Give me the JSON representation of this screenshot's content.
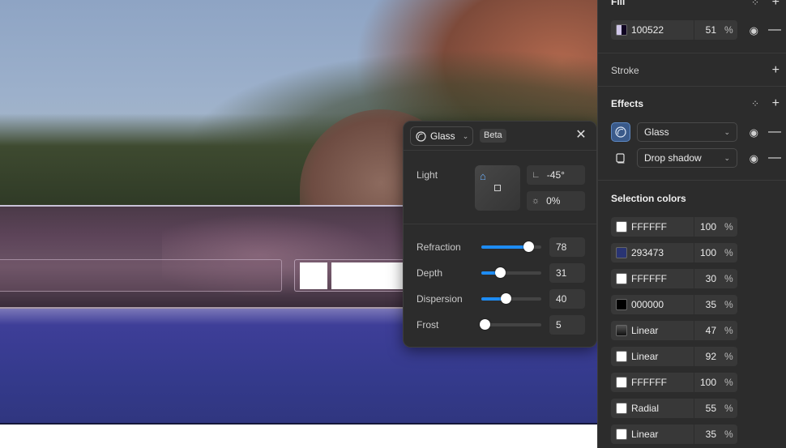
{
  "effect_popup": {
    "effect_name": "Glass",
    "beta_label": "Beta",
    "light_label": "Light",
    "angle": "-45°",
    "intensity": "0%",
    "sliders": [
      {
        "label": "Refraction",
        "value": "78",
        "level": 0.78
      },
      {
        "label": "Depth",
        "value": "31",
        "level": 0.31
      },
      {
        "label": "Dispersion",
        "value": "40",
        "level": 0.4
      },
      {
        "label": "Frost",
        "value": "5",
        "level": 0.05
      }
    ]
  },
  "panel": {
    "fill": {
      "title": "Fill",
      "hex": "100522",
      "opacity": "51",
      "percent_sign": "%",
      "swatch_color": "#100522"
    },
    "stroke": {
      "title": "Stroke"
    },
    "effects": {
      "title": "Effects",
      "items": [
        {
          "label": "Glass",
          "icon": "glass-effect-icon"
        },
        {
          "label": "Drop shadow",
          "icon": "drop-shadow-icon"
        }
      ]
    },
    "selection_colors": {
      "title": "Selection colors",
      "items": [
        {
          "hex": "FFFFFF",
          "opacity": "100",
          "swatch": "#ffffff"
        },
        {
          "hex": "293473",
          "opacity": "100",
          "swatch": "#293473"
        },
        {
          "hex": "FFFFFF",
          "opacity": "30",
          "swatch": "#ffffff"
        },
        {
          "hex": "000000",
          "opacity": "35",
          "swatch": "#000000"
        },
        {
          "hex": "Linear",
          "opacity": "47",
          "swatch": "linear-gradient(180deg,#555,#111)"
        },
        {
          "hex": "Linear",
          "opacity": "92",
          "swatch": "#ffffff"
        },
        {
          "hex": "FFFFFF",
          "opacity": "100",
          "swatch": "#ffffff"
        },
        {
          "hex": "Radial",
          "opacity": "55",
          "swatch": "#ffffff"
        },
        {
          "hex": "Linear",
          "opacity": "35",
          "swatch": "#ffffff"
        }
      ],
      "percent_sign": "%"
    }
  },
  "colors": {
    "accent": "#1e8cf3",
    "panel_bg": "#2c2c2c",
    "canvas_blue": "#343a8c"
  }
}
